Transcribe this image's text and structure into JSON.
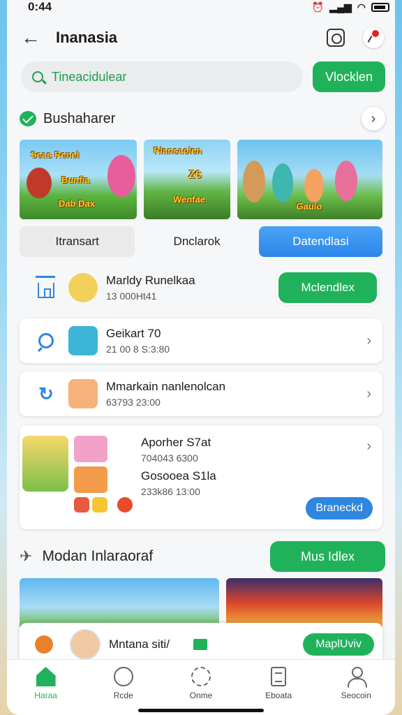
{
  "status": {
    "time": "0:44"
  },
  "header": {
    "title": "Inanasia"
  },
  "search": {
    "placeholder": "Tineacidulear",
    "button_label": "Vlocklen"
  },
  "featured": {
    "title": "Bushaharer",
    "banners": [
      {
        "line1": "Seas Renel",
        "line2": "Bunfia",
        "line3": "Dab Dax"
      },
      {
        "line1": "Rlansaolen",
        "line2": "Z6",
        "line3": "Wenfae"
      },
      {
        "line1": "",
        "line2": "",
        "line3": "Gaulo"
      }
    ]
  },
  "tabs": [
    "Itransart",
    "Dnclarok",
    "Datendlasi"
  ],
  "list": [
    {
      "name": "Marldy Runelkaa",
      "sub": "13 000Ht41",
      "action": "Mclendlex",
      "icon": "house-icon"
    },
    {
      "name": "Geikart 70",
      "sub": "21 00 8 S:3:80",
      "icon": "chat-bubble-icon"
    },
    {
      "name": "Mmarkain nanlenolcan",
      "sub": "63793 23:00",
      "icon": "six-icon"
    }
  ],
  "group_card": {
    "items": [
      {
        "name": "Aporher S7at",
        "sub": "704043 6300"
      },
      {
        "name": "Gosooea S1la",
        "sub": "233k86 13:00"
      }
    ],
    "button_label": "Braneckd"
  },
  "section2": {
    "title": "Modan Inlaraoraf",
    "button_label": "Mus Idlex"
  },
  "bottom_card": {
    "name": "Mntana siti/",
    "button_label": "MaplUviv"
  },
  "nav": [
    "Haraa",
    "Rcde",
    "Onme",
    "Eboata",
    "Seocoin"
  ],
  "colors": {
    "green": "#20b25a",
    "blue": "#2f86de"
  }
}
